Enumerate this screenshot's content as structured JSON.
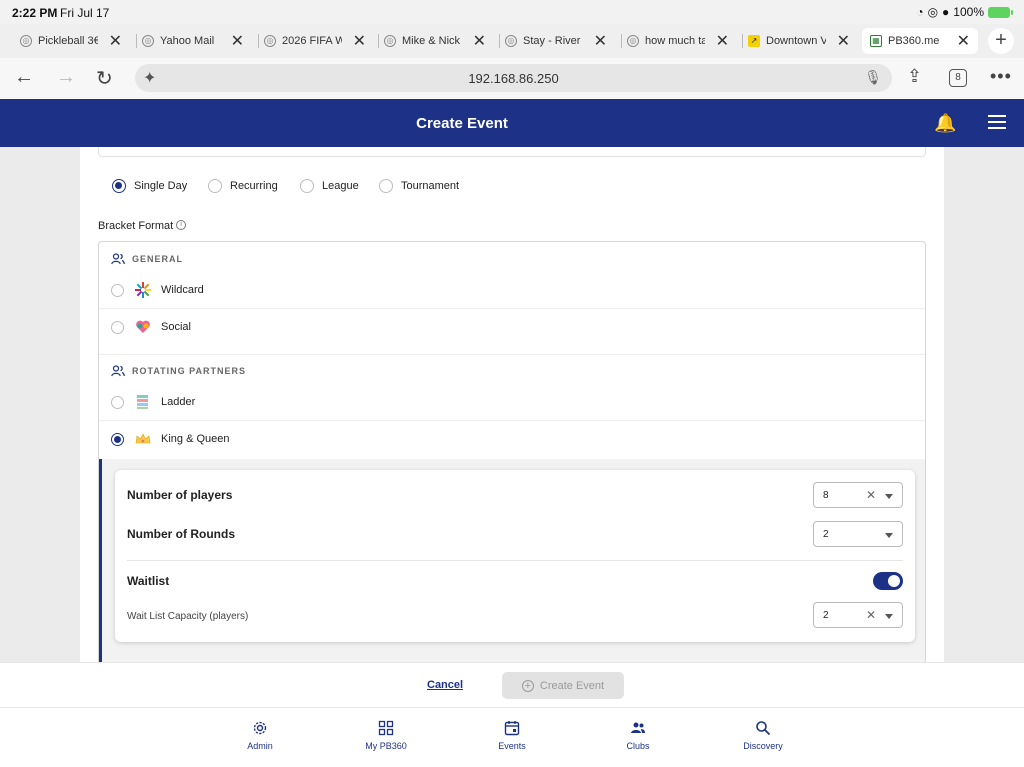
{
  "status": {
    "time": "2:22 PM",
    "date": "Fri Jul 17",
    "battery": "100%"
  },
  "tabs": [
    {
      "name": "Pickleball 3€",
      "favicon": "globe-icon"
    },
    {
      "name": "Yahoo Mail",
      "favicon": "globe-icon"
    },
    {
      "name": "2026 FIFA W",
      "favicon": "globe-icon"
    },
    {
      "name": "Mike & Nick",
      "favicon": "globe-icon"
    },
    {
      "name": "Stay - River",
      "favicon": "globe-icon"
    },
    {
      "name": "how much ta",
      "favicon": "globe-icon"
    },
    {
      "name": "Downtown V",
      "favicon": "arrow-icon"
    },
    {
      "name": "PB360.me",
      "favicon": "pb360-icon",
      "active": true
    }
  ],
  "address": {
    "url": "192.168.86.250",
    "tab_count": "8"
  },
  "header": {
    "title": "Create Event"
  },
  "event_types": [
    {
      "label": "Single Day",
      "selected": true
    },
    {
      "label": "Recurring",
      "selected": false
    },
    {
      "label": "League",
      "selected": false
    },
    {
      "label": "Tournament",
      "selected": false
    }
  ],
  "bracket": {
    "label": "Bracket Format",
    "groups": [
      {
        "title": "GENERAL",
        "options": [
          {
            "label": "Wildcard",
            "selected": false
          },
          {
            "label": "Social",
            "selected": false
          }
        ]
      },
      {
        "title": "ROTATING PARTNERS",
        "options": [
          {
            "label": "Ladder",
            "selected": false
          },
          {
            "label": "King & Queen",
            "selected": true
          }
        ]
      }
    ]
  },
  "settings": {
    "players": {
      "label": "Number of players",
      "value": "8"
    },
    "rounds": {
      "label": "Number of Rounds",
      "value": "2"
    },
    "waitlist": {
      "label": "Waitlist",
      "enabled": true
    },
    "waitlist_capacity": {
      "label": "Wait List Capacity (players)",
      "value": "2"
    }
  },
  "actions": {
    "cancel": "Cancel",
    "create": "Create Event"
  },
  "bottom_nav": [
    {
      "label": "Admin",
      "icon": "gear-icon"
    },
    {
      "label": "My PB360",
      "icon": "grid-icon"
    },
    {
      "label": "Events",
      "icon": "calendar-icon"
    },
    {
      "label": "Clubs",
      "icon": "people-icon"
    },
    {
      "label": "Discovery",
      "icon": "search-icon"
    }
  ],
  "colors": {
    "brand": "#1d3287",
    "accent_green": "#5fd35f"
  }
}
